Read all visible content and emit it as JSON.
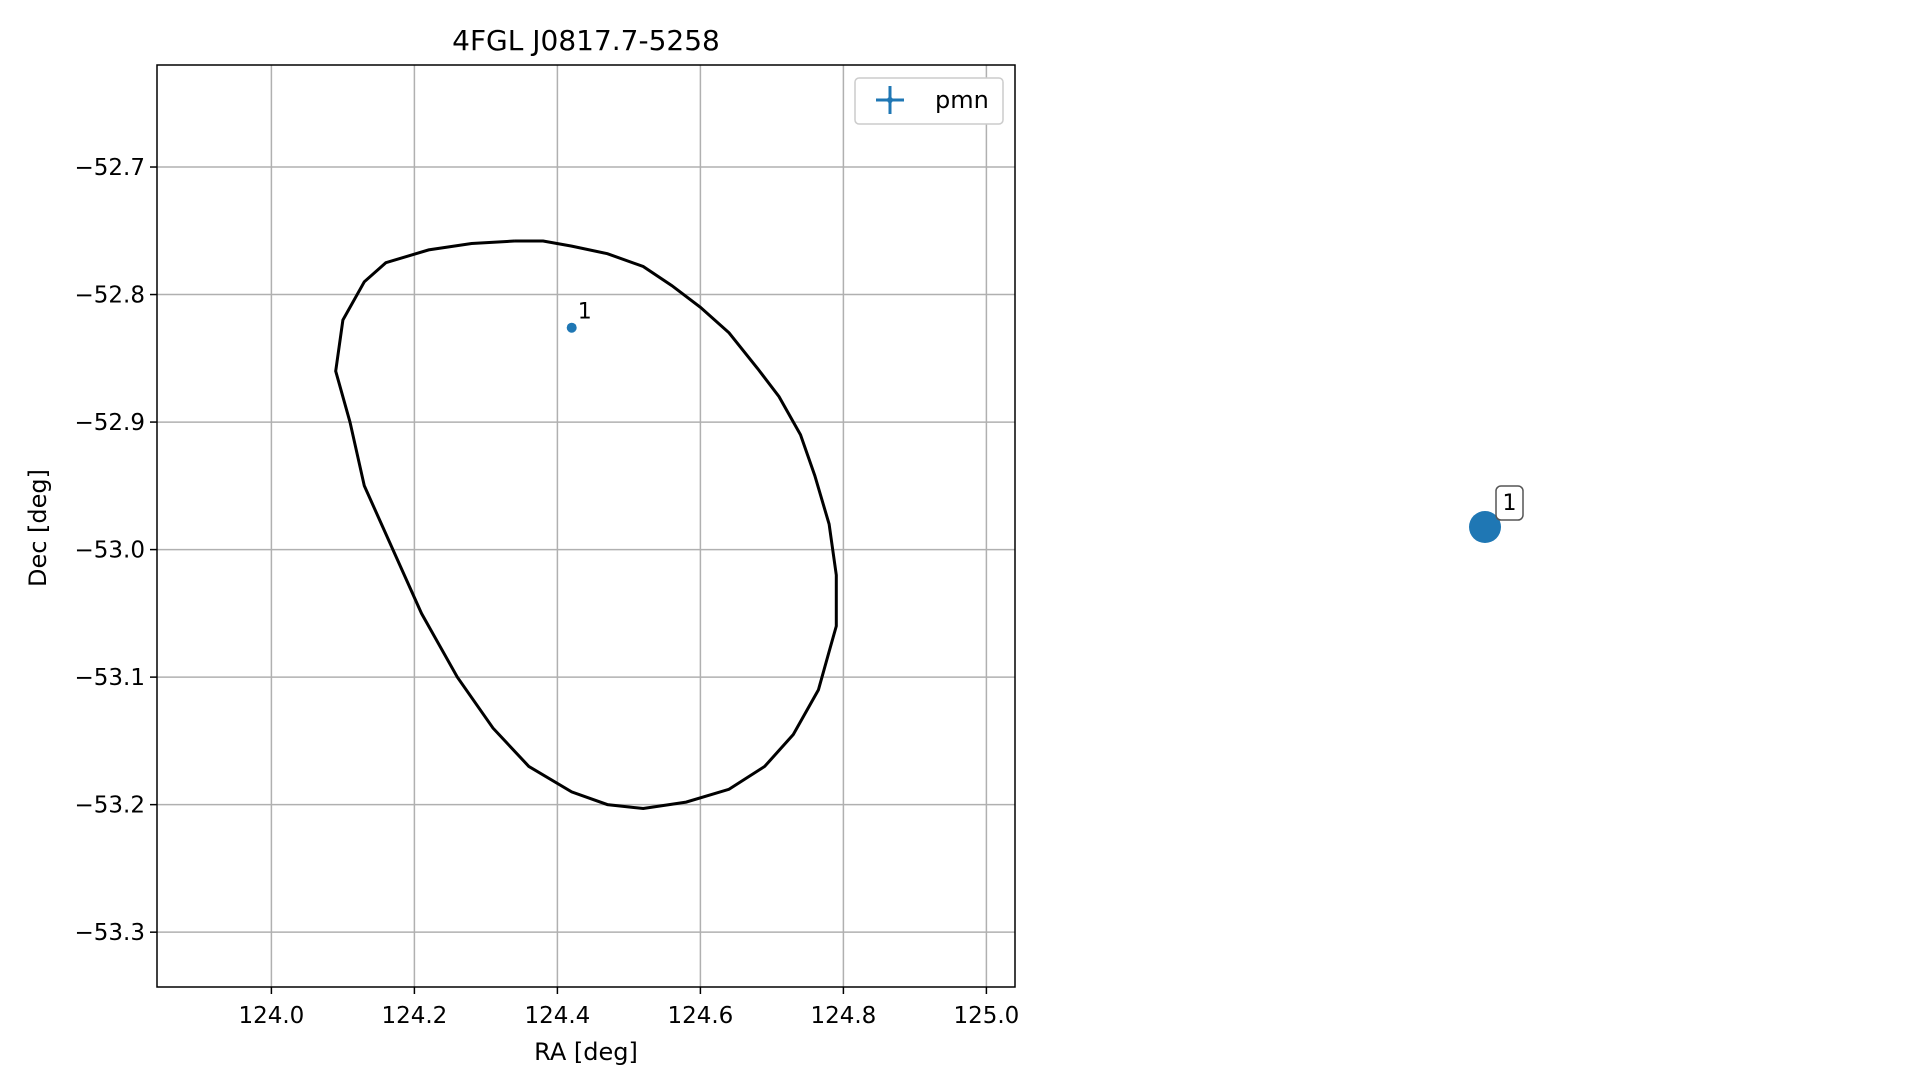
{
  "chart_data": [
    {
      "type": "scatter",
      "title": "4FGL J0817.7-5258",
      "xlabel": "RA [deg]",
      "ylabel": "Dec [deg]",
      "xlim": [
        123.84,
        125.04
      ],
      "ylim": [
        -53.343,
        -52.62
      ],
      "grid": true,
      "legend_position": "top-right",
      "x_ticks": [
        124.0,
        124.2,
        124.4,
        124.6,
        124.8,
        125.0
      ],
      "x_tick_labels": [
        "124.0",
        "124.2",
        "124.4",
        "124.6",
        "124.8",
        "125.0"
      ],
      "y_ticks": [
        -52.7,
        -52.8,
        -52.9,
        -53.0,
        -53.1,
        -53.2,
        -53.3
      ],
      "y_tick_labels": [
        "−52.7",
        "−52.8",
        "−52.9",
        "−53.0",
        "−53.1",
        "−53.2",
        "−53.3"
      ],
      "series": [
        {
          "name": "pmn",
          "marker": "errorbar-point",
          "color": "#1f77b4",
          "points": [
            {
              "x": 124.42,
              "y": -52.826,
              "label": "1"
            }
          ]
        }
      ],
      "ellipse": {
        "color": "#000000",
        "points": [
          [
            124.34,
            -52.758
          ],
          [
            124.38,
            -52.758
          ],
          [
            124.42,
            -52.762
          ],
          [
            124.47,
            -52.768
          ],
          [
            124.52,
            -52.778
          ],
          [
            124.56,
            -52.793
          ],
          [
            124.6,
            -52.81
          ],
          [
            124.64,
            -52.83
          ],
          [
            124.68,
            -52.858
          ],
          [
            124.71,
            -52.88
          ],
          [
            124.74,
            -52.91
          ],
          [
            124.76,
            -52.942
          ],
          [
            124.78,
            -52.98
          ],
          [
            124.79,
            -53.02
          ],
          [
            124.79,
            -53.06
          ],
          [
            124.78,
            -53.08
          ],
          [
            124.765,
            -53.11
          ],
          [
            124.73,
            -53.145
          ],
          [
            124.69,
            -53.17
          ],
          [
            124.64,
            -53.188
          ],
          [
            124.58,
            -53.198
          ],
          [
            124.52,
            -53.203
          ],
          [
            124.47,
            -53.2
          ],
          [
            124.42,
            -53.19
          ],
          [
            124.36,
            -53.17
          ],
          [
            124.31,
            -53.14
          ],
          [
            124.26,
            -53.1
          ],
          [
            124.21,
            -53.05
          ],
          [
            124.17,
            -53.0
          ],
          [
            124.13,
            -52.95
          ],
          [
            124.11,
            -52.9
          ],
          [
            124.09,
            -52.86
          ],
          [
            124.1,
            -52.82
          ],
          [
            124.13,
            -52.79
          ],
          [
            124.16,
            -52.775
          ],
          [
            124.22,
            -52.765
          ],
          [
            124.28,
            -52.76
          ],
          [
            124.34,
            -52.758
          ]
        ]
      }
    },
    {
      "type": "scatter",
      "title": "",
      "axes_visible": false,
      "series": [
        {
          "color": "#1f77b4",
          "points": [
            {
              "label": "1"
            }
          ]
        }
      ]
    }
  ]
}
